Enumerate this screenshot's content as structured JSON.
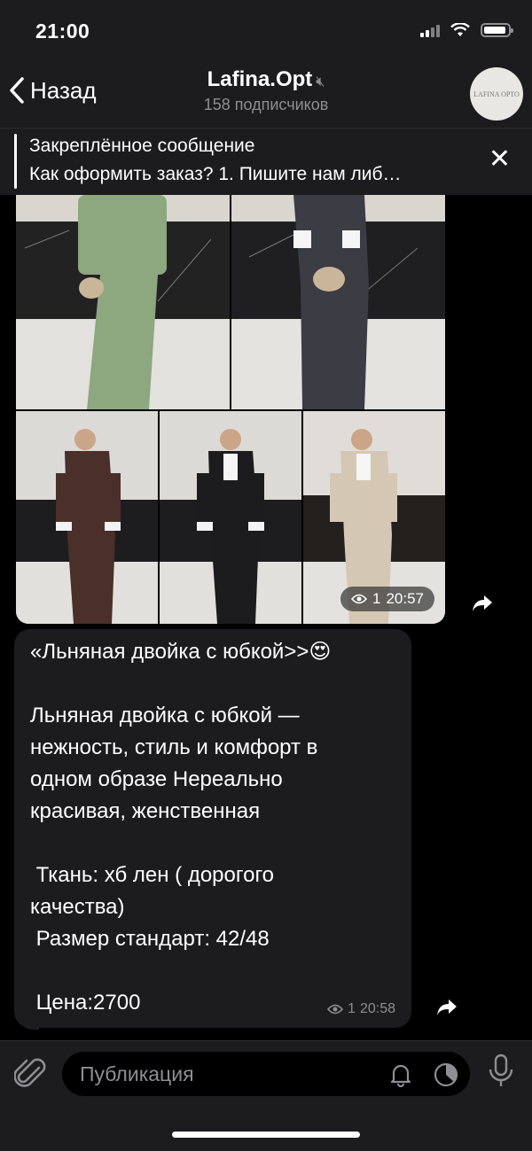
{
  "status": {
    "time": "21:00"
  },
  "header": {
    "back_label": "Назад",
    "title": "Lafina.Opt",
    "subtitle": "158 подписчиков",
    "avatar_text": "LAFINA OPTO"
  },
  "pinned": {
    "title": "Закреплённое сообщение",
    "text": "Как оформить заказ? 1. Пишите нам либ…"
  },
  "album": {
    "photos": [
      {
        "color": "#8da77f"
      },
      {
        "color": "#3b3c44"
      },
      {
        "color": "#4a2f2a"
      },
      {
        "color": "#1c1c1e"
      },
      {
        "color": "#d4c8b4"
      }
    ],
    "views": "1",
    "time": "20:57"
  },
  "post": {
    "text": "«Льняная двойка с юбкой>>😍\n\nЛьняная двойка с юбкой —\nнежность, стиль и комфорт в\nодном образе Нереально\nкрасивая, женственная\n\n Ткань: хб лен ( дорогого\nкачества)\n Размер стандарт: 42/48\n\n Цена:2700",
    "views": "1",
    "time": "20:58"
  },
  "composer": {
    "placeholder": "Публикация"
  }
}
